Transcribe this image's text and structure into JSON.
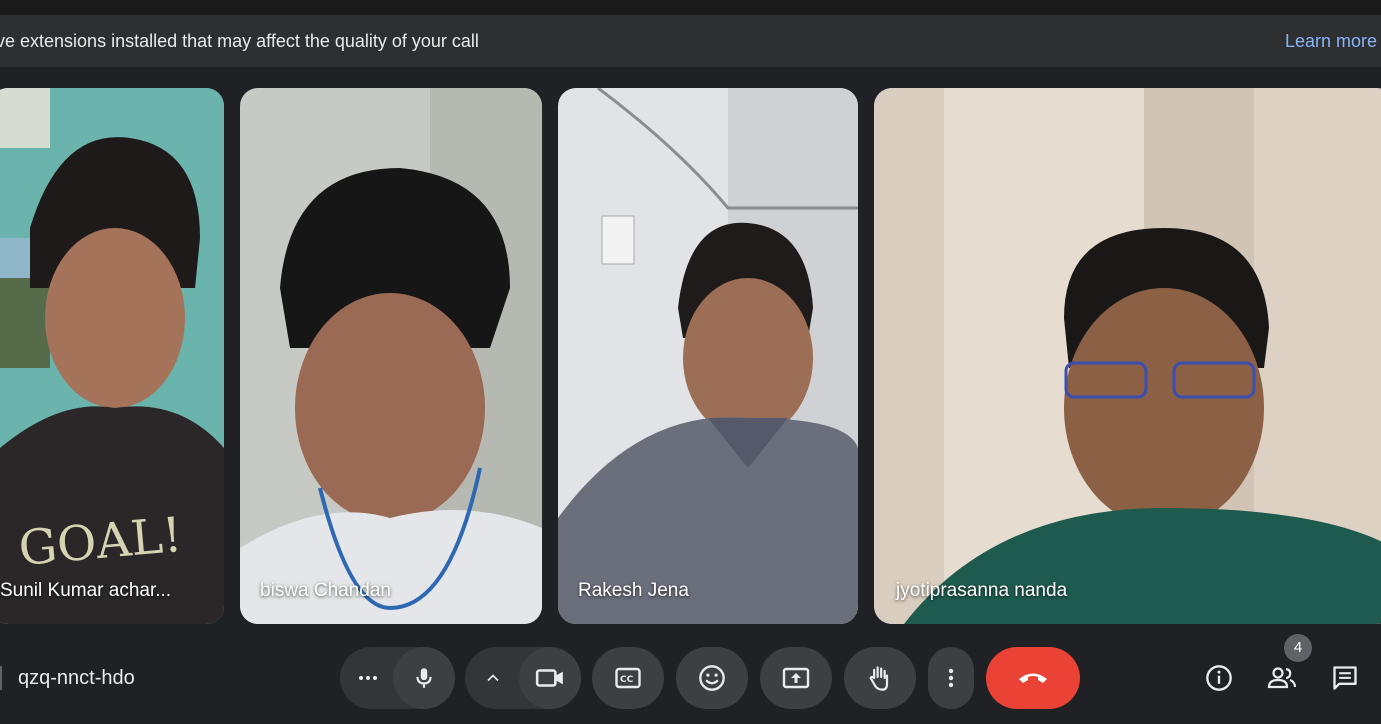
{
  "banner": {
    "message": "ve extensions installed that may affect the quality of your call",
    "learn_more": "Learn more"
  },
  "participants": [
    {
      "name": "Sunil Kumar achar...",
      "active_speaker": false
    },
    {
      "name": "biswa Chandan",
      "active_speaker": false
    },
    {
      "name": "Rakesh Jena",
      "active_speaker": false
    },
    {
      "name": "jyotiprasanna nanda",
      "active_speaker": true
    }
  ],
  "meeting": {
    "code": "qzq-nnct-hdo"
  },
  "controls": {
    "more_audio": "more-options-icon",
    "mic": "microphone-icon",
    "video_options": "chevron-up-icon",
    "camera": "camera-icon",
    "captions": "closed-captions-icon",
    "reactions": "emoji-icon",
    "present": "present-screen-icon",
    "raise_hand": "raise-hand-icon",
    "more": "more-vert-icon",
    "leave": "end-call-icon"
  },
  "side": {
    "info": "info-icon",
    "people": "people-icon",
    "people_count": "4",
    "chat": "chat-icon"
  },
  "colors": {
    "end_call": "#ea4335",
    "active_border": "#a8c7fa",
    "link": "#8ab4f8",
    "control_bg": "#3c4043"
  }
}
